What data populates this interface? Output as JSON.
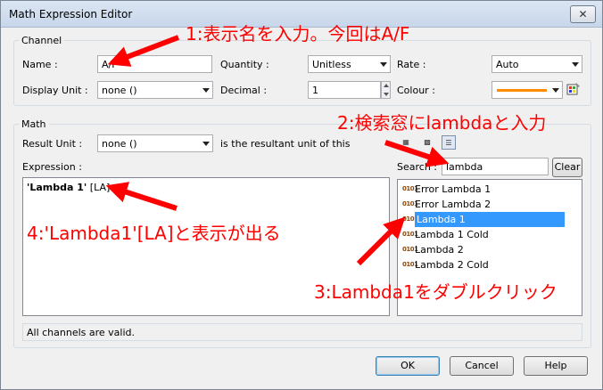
{
  "window": {
    "title": "Math Expression Editor",
    "close_label": "✕"
  },
  "channel": {
    "group_label": "Channel",
    "name_label": "Name :",
    "name_value": "A/F",
    "display_unit_label": "Display Unit :",
    "display_unit_value": "none ()",
    "quantity_label": "Quantity :",
    "quantity_value": "Unitless",
    "decimal_label": "Decimal :",
    "decimal_value": "1",
    "rate_label": "Rate :",
    "rate_value": "Auto",
    "colour_label": "Colour :",
    "colour_value": "#ff8c00"
  },
  "math": {
    "group_label": "Math",
    "result_unit_label": "Result Unit :",
    "result_unit_value": "none ()",
    "result_unit_note": "is the resultant unit of this",
    "expression_label": "Expression :",
    "expression_bold": "'Lambda 1'",
    "expression_unit": " [LA]",
    "search_label": "Search :",
    "search_value": "lambda",
    "clear_label": "Clear",
    "channel_icon_text": "0101",
    "results": [
      {
        "label": "Error Lambda 1",
        "selected": false
      },
      {
        "label": "Error Lambda 2",
        "selected": false
      },
      {
        "label": "Lambda 1",
        "selected": true
      },
      {
        "label": "Lambda 1 Cold",
        "selected": false
      },
      {
        "label": "Lambda 2",
        "selected": false
      },
      {
        "label": "Lambda 2 Cold",
        "selected": false
      }
    ]
  },
  "status": {
    "text": "All channels are valid."
  },
  "buttons": {
    "ok": "OK",
    "cancel": "Cancel",
    "help": "Help"
  },
  "annotations": {
    "a1": "1:表示名を入力。今回はA/F",
    "a2": "2:検索窓にlambdaと入力",
    "a3": "3:Lambda1をダブルクリック",
    "a4": "4:'Lambda1'[LA]と表示が出る",
    "color": "#ff0000"
  }
}
